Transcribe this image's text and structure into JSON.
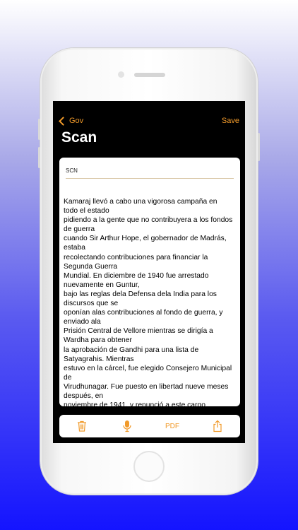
{
  "status": {
    "carrier": "",
    "time": "",
    "battery": ""
  },
  "nav": {
    "back_label": "Gov",
    "save_label": "Save"
  },
  "page_title": "Scan",
  "document": {
    "title": "SCN",
    "lines": [
      "Kamaraj llevó a cabo una vigorosa campaña en todo el estado",
      "pidiendo a la gente que no contribuyera a los fondos de guerra",
      "cuando Sir Arthur Hope, el gobernador de Madrás, estaba",
      "recolectando contribuciones para financiar la Segunda Guerra",
      "Mundial. En diciembre de 1940 fue arrestado nuevamente en Guntur,",
      "bajo las reglas dela Defensa dela India para los discursos que se",
      "oponían alas contribuciones al fondo de guerra, y enviado ala",
      "Prisión Central de Vellore mientras se dirigía a Wardha para obtener",
      "la aprobación de Gandhi para una lista de Satyagrahis. Mientras",
      "estuvo en la cárcel, fue elegido Consejero Municipal de",
      "Virudhunagar. Fue puesto en libertad nueve meses después, en",
      "noviembre de 1941, y renunció a este cargo"
    ]
  },
  "toolbar": {
    "trash_icon": "trash-icon",
    "mic_icon": "microphone-icon",
    "pdf_label": "PDF",
    "share_icon": "share-icon"
  },
  "colors": {
    "accent": "#f19a2a",
    "screen_bg": "#000000",
    "card_bg": "#ffffff"
  }
}
